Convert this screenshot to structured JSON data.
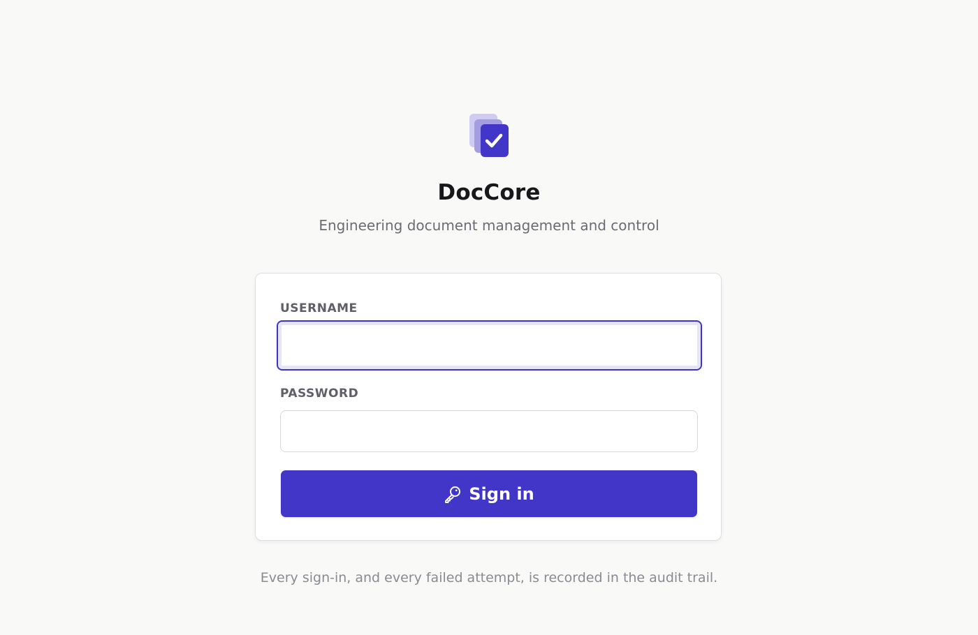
{
  "app": {
    "name": "DocCore",
    "tagline": "Engineering document management and control",
    "logo_icon": "stacked-documents-check-icon"
  },
  "login_form": {
    "username_label": "USERNAME",
    "username_value": "",
    "username_placeholder": "",
    "password_label": "PASSWORD",
    "password_value": "",
    "password_placeholder": "",
    "submit_label": "Sign in",
    "submit_icon": "key-icon"
  },
  "footer": {
    "note": "Every sign-in, and every failed attempt, is recorded in the audit trail."
  },
  "colors": {
    "accent": "#4236c9",
    "background": "#f9f9f8",
    "card": "#ffffff",
    "logo_back": "#c8c5ef",
    "logo_mid": "#a59ee3"
  }
}
